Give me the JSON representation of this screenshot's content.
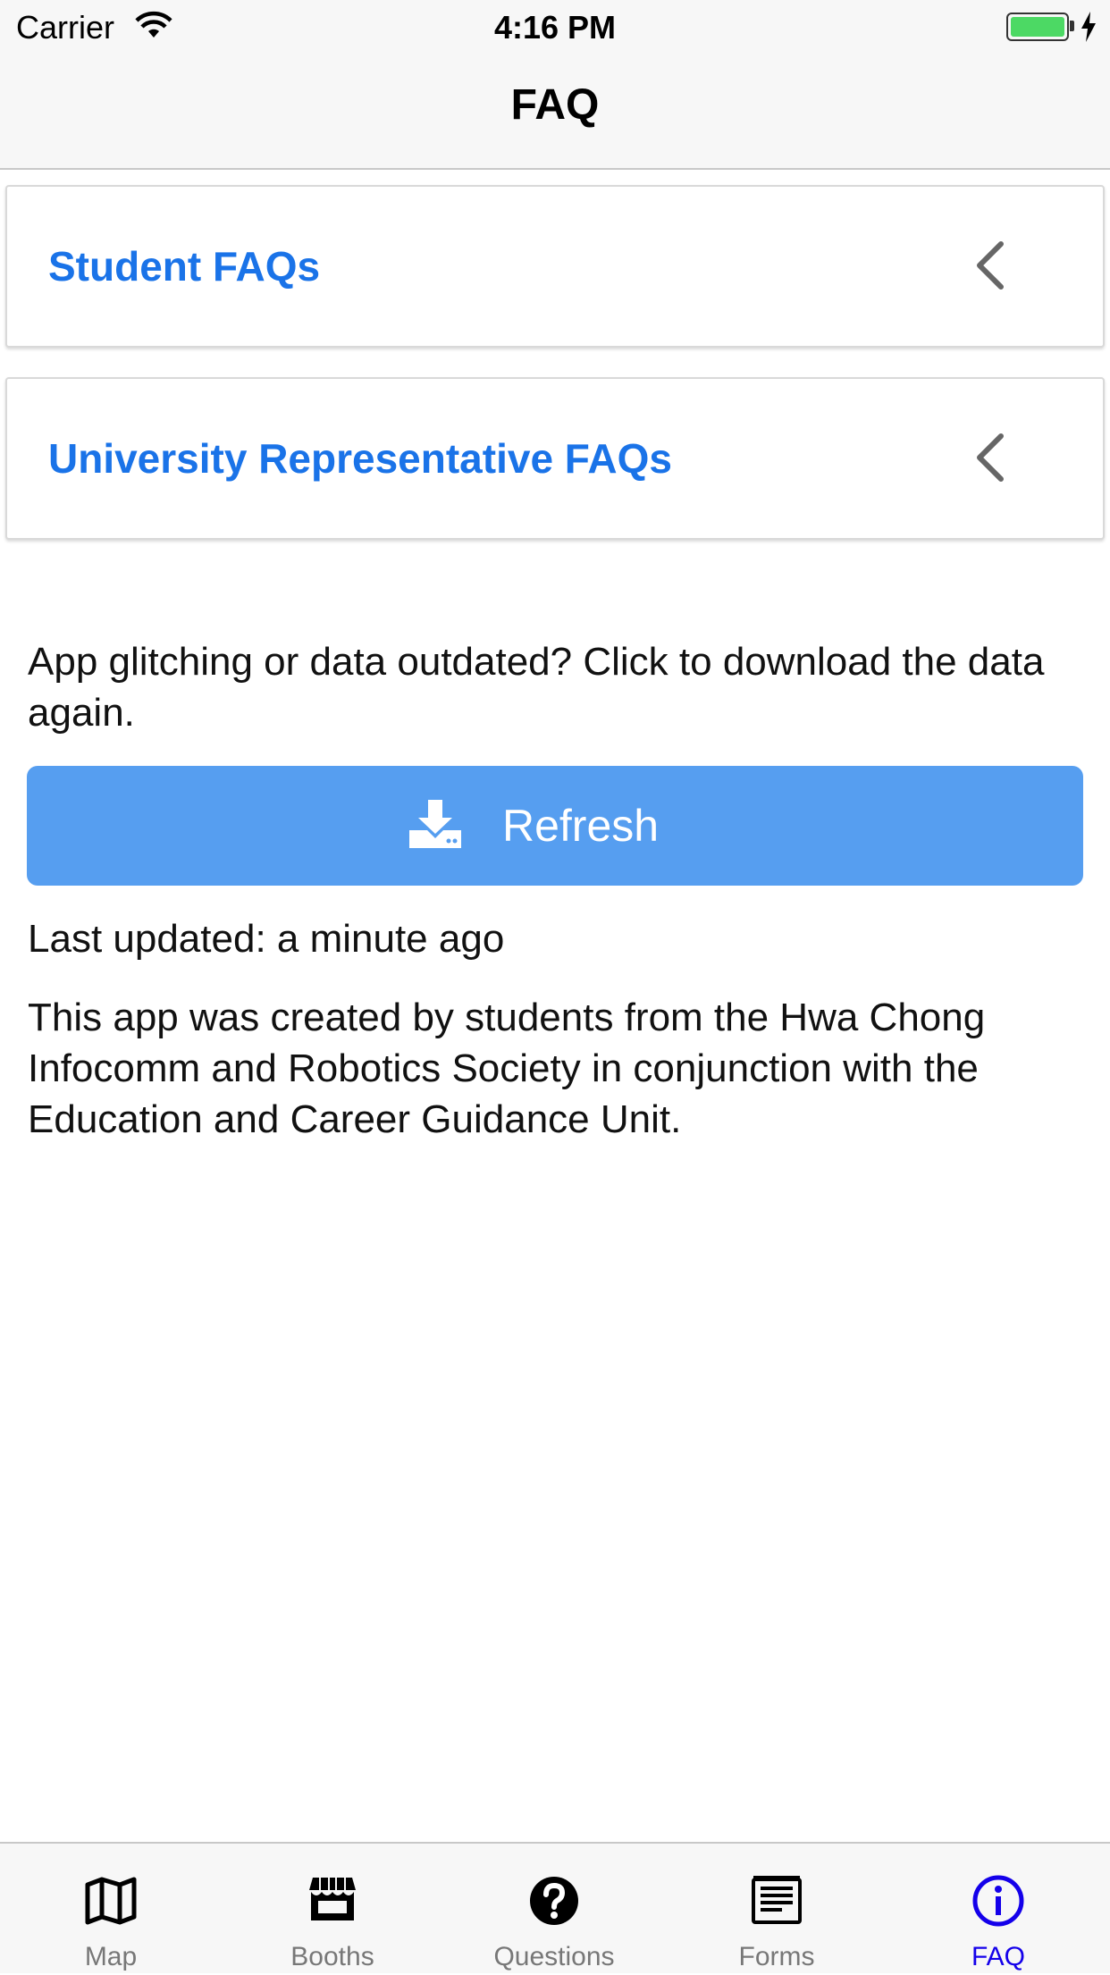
{
  "status_bar": {
    "carrier": "Carrier",
    "time": "4:16 PM"
  },
  "nav": {
    "title": "FAQ"
  },
  "faq_sections": [
    {
      "label": "Student FAQs",
      "icon": "chevron-left-icon"
    },
    {
      "label": "University Representative FAQs",
      "icon": "chevron-left-icon"
    }
  ],
  "refresh": {
    "prompt": "App glitching or data outdated? Click to download the data again.",
    "button_label": "Refresh",
    "icon": "download-icon",
    "last_updated": "Last updated: a minute ago"
  },
  "about": "This app was created by students from the Hwa Chong Infocomm and Robotics Society in conjunction with the Education and Career Guidance Unit.",
  "tabs": [
    {
      "label": "Map",
      "icon": "map-icon",
      "active": false
    },
    {
      "label": "Booths",
      "icon": "store-icon",
      "active": false
    },
    {
      "label": "Questions",
      "icon": "question-circle-icon",
      "active": false
    },
    {
      "label": "Forms",
      "icon": "forms-icon",
      "active": false
    },
    {
      "label": "FAQ",
      "icon": "info-circle-icon",
      "active": true
    }
  ],
  "colors": {
    "accent": "#1a73e8",
    "button": "#569ef0",
    "tab_active": "#1400ea"
  }
}
